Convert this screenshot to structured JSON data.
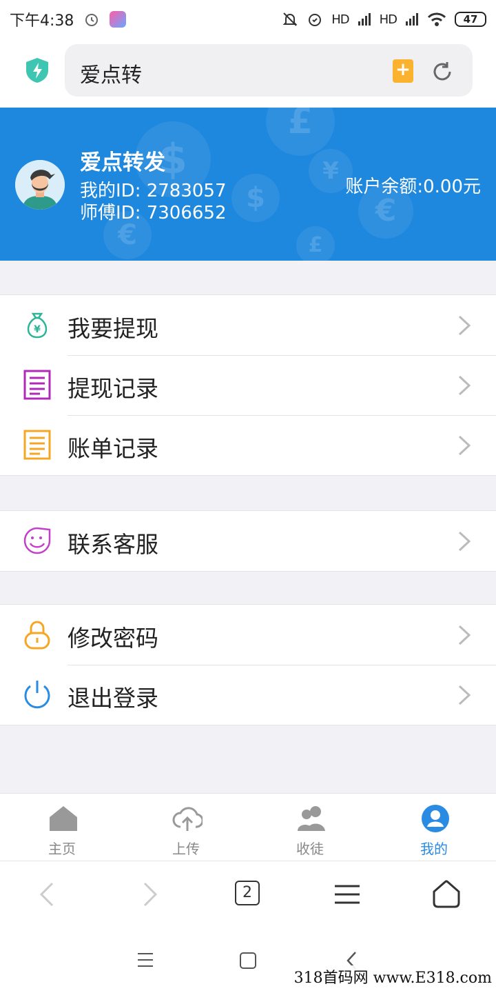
{
  "status_bar": {
    "time": "下午4:38",
    "battery": "47",
    "signal1": "HD",
    "signal2": "HD"
  },
  "browser": {
    "url_text": "爱点转",
    "tab_count": "2"
  },
  "profile": {
    "nickname": "爱点转发",
    "my_id": "我的ID: 2783057",
    "master_id": "师傅ID: 7306652",
    "balance": "账户余额:0.00元"
  },
  "menu": {
    "withdraw": "我要提现",
    "withdraw_records": "提现记录",
    "bill_records": "账单记录",
    "contact_service": "联系客服",
    "change_password": "修改密码",
    "logout": "退出登录"
  },
  "tabbar": {
    "home": "主页",
    "upload": "上传",
    "apprentice": "收徒",
    "mine": "我的"
  },
  "colors": {
    "banner": "#1e87de",
    "active_tab": "#2a8be3",
    "withdraw_icon": "#2bb598",
    "records_icon": "#b02ab8",
    "bill_icon": "#f5a623",
    "service_icon": "#c33fc9",
    "password_icon": "#f5a623",
    "logout_icon": "#2a8be3"
  },
  "watermark": "318首码网  www.E318.com"
}
